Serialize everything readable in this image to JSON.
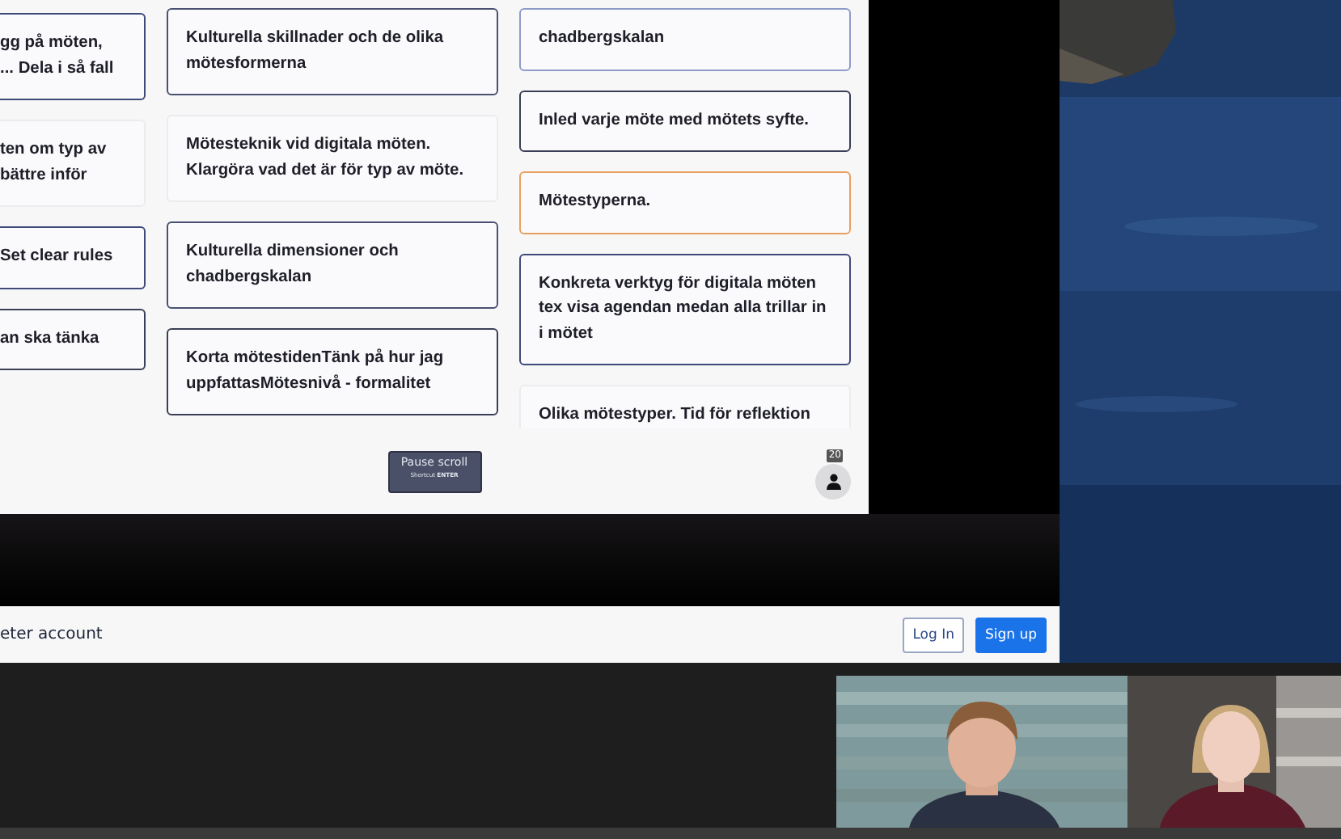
{
  "board": {
    "columns": [
      {
        "cut": true,
        "cards": [
          {
            "text": "gg på möten,\n... Dela i så fall",
            "color": "#3f4a7a"
          },
          {
            "text": "ten om typ av\nbättre inför"
          },
          {
            "text": "Set clear rules",
            "color": "#3f4a7a"
          },
          {
            "text": "an ska tänka",
            "color": "#3a3f55"
          }
        ]
      },
      {
        "cut": false,
        "cards": [
          {
            "text": "Kulturella skillnader och de olika mötesformerna",
            "color": "#4a5170"
          },
          {
            "text": "Mötesteknik vid digitala möten. Klargöra vad det är för typ av möte."
          },
          {
            "text": "Kulturella dimensioner och chadbergskalan",
            "color": "#4a5170"
          },
          {
            "text": "Korta mötestidenTänk på hur jag uppfattasMötesnivå - formalitet",
            "color": "#3a3f55"
          }
        ]
      },
      {
        "cut": false,
        "cards": [
          {
            "text": "chadbergskalan",
            "color": "#8e9bc9"
          },
          {
            "text": "Inled varje möte med mötets syfte.",
            "color": "#3a3f55"
          },
          {
            "text": "Mötestyperna.",
            "color": "#e8a060"
          },
          {
            "text": "Konkreta verktyg för digitala möten tex visa agendan medan alla trillar in i mötet",
            "color": "#3f4a7a"
          },
          {
            "text": "Olika mötestyper. Tid för reflektion"
          }
        ]
      }
    ]
  },
  "footer": {
    "pause_button": {
      "label": "Pause scroll",
      "shortcut_label": "Shortcut",
      "shortcut_key": "ENTER"
    },
    "participants_count": "20"
  },
  "account_bar": {
    "text": "eter account",
    "buttons": [
      {
        "label": "Log In",
        "kind": "outline"
      },
      {
        "label": "Sign up",
        "kind": "primary"
      }
    ]
  }
}
